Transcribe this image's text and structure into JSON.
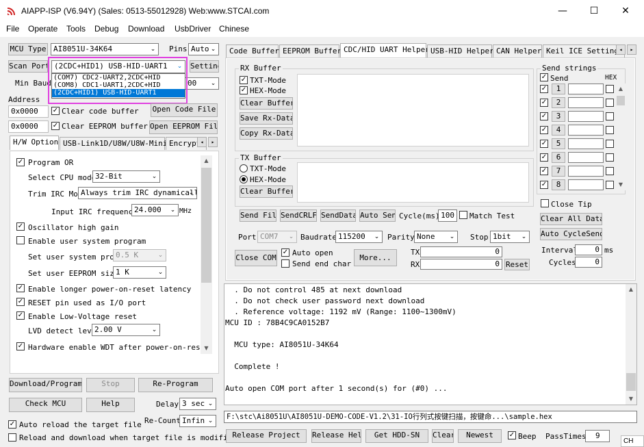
{
  "window": {
    "title": "AIAPP-ISP (V6.94Y) (Sales: 0513-55012928) Web:www.STCAI.com"
  },
  "menu": [
    "File",
    "Operate",
    "Tools",
    "Debug",
    "Download",
    "UsbDriver",
    "Chinese"
  ],
  "left": {
    "mcu_type_label": "MCU Type",
    "mcu_type_value": "AI8051U-34K64",
    "pins_label": "Pins",
    "pins_value": "Auto",
    "scan_port_label": "Scan Port",
    "port_value": "(2CDC+HID1) USB-HID-UART1",
    "port_options": [
      "(COM7) CDC2-UART2,2CDC+HID",
      "(COM8) CDC1-UART1,2CDC+HID",
      "(2CDC+HID1) USB-HID-UART1"
    ],
    "setting_label": "Setting",
    "min_baud_label": "Min Baud",
    "baud_partial": "00",
    "address_label": "Address",
    "addr1": "0x0000",
    "clear_code": "Clear code buffer",
    "open_code": "Open Code File",
    "addr2": "0x0000",
    "clear_eeprom": "Clear EEPROM buffer",
    "open_eeprom": "Open EEPROM File"
  },
  "hw_tabs": [
    "H/W Option",
    "USB-Link1D/U8W/U8W-Mini",
    "Encrypti"
  ],
  "hw": {
    "program_or": "Program OR",
    "cpu_mode_label": "Select CPU mode",
    "cpu_mode_value": "32-Bit",
    "trim_label": "Trim IRC Mo",
    "trim_value": "Always trim IRC dynamicall",
    "irc_label": "Input IRC frequency",
    "irc_value": "24.000",
    "irc_unit": "MHz",
    "osc_gain": "Oscillator high gain",
    "user_sys": "Enable user system program",
    "user_sys_prog_label": "Set user system prog",
    "user_sys_prog_value": "0.5 K",
    "eeprom_label": "Set user EEPROM size",
    "eeprom_value": "1  K",
    "longer_por": "Enable longer power-on-reset latency",
    "reset_io": "RESET pin used as I/O port",
    "low_volt": "Enable Low-Voltage reset",
    "lvd_label": "LVD detect leve",
    "lvd_value": "2.00 V",
    "wdt": "Hardware enable WDT after power-on-reset"
  },
  "bottom_left": {
    "download": "Download/Program",
    "stop": "Stop",
    "reprogram": "Re-Program",
    "check_mcu": "Check MCU",
    "help": "Help",
    "delay_label": "Delay",
    "delay_value": "3 sec",
    "recount_label": "Re-Count",
    "recount_value": "Infin",
    "auto_reload": "Auto reload the target file",
    "reload_dl": "Reload and download when target file is modified"
  },
  "right_tabs": [
    "Code Buffer",
    "EEPROM Buffer",
    "CDC/HID UART Helper",
    "USB-HID Helper",
    "CAN Helper",
    "Keil ICE Settings"
  ],
  "uart": {
    "rx_title": "RX Buffer",
    "rx_txt": "TXT-Mode",
    "rx_hex": "HEX-Mode",
    "clear_buffer": "Clear Buffer",
    "save_rx": "Save Rx-Data",
    "copy_rx": "Copy Rx-Data",
    "tx_title": "TX Buffer",
    "tx_txt": "TXT-Mode",
    "tx_hex": "HEX-Mode",
    "tx_clear": "Clear Buffer",
    "send_file": "Send File",
    "send_crlf": "SendCRLF",
    "send_data": "SendData",
    "auto_send": "Auto Send",
    "cycle_label": "Cycle(ms)",
    "cycle_value": "100",
    "match_test": "Match Test",
    "port_label": "Port",
    "port_value": "COM7",
    "baud_label": "Baudrate",
    "baud_value": "115200",
    "parity_label": "Parity",
    "parity_value": "None",
    "stop_label": "Stop",
    "stop_value": "1bit",
    "close_com": "Close COM",
    "auto_open": "Auto open",
    "send_end": "Send end char",
    "more": "More...",
    "tx_label": "TX",
    "tx_count": "0",
    "rx_label": "RX",
    "rx_count": "0",
    "reset": "Reset",
    "send_strings_title": "Send strings",
    "send_header": "Send",
    "hex_header": "HEX",
    "send_nums": [
      "1",
      "2",
      "3",
      "4",
      "5",
      "6",
      "7",
      "8"
    ],
    "close_tip": "Close Tip",
    "clear_all": "Clear All Data",
    "auto_cycle": "Auto CycleSend",
    "interval_label": "Interval",
    "interval_value": "0",
    "interval_unit": "ms",
    "cycles_label": "Cycles",
    "cycles_value": "0"
  },
  "log": [
    "  . Do not control 485 at next download",
    "  . Do not check user password next download",
    "  . Reference voltage: 1192 mV (Range: 1100~1300mV)",
    "MCU ID : 78B4C9CA0152B7",
    "",
    "  MCU type: AI8051U-34K64",
    "",
    "  Complete !",
    "",
    "Auto open COM port after 1 second(s) for (#0) ..."
  ],
  "file_path": "F:\\stc\\Ai8051U\\AI8051U-DEMO-CODE-V1.2\\31-IO行列式按键扫描，按键命...\\sample.hex",
  "status": {
    "release_project": "Release Project",
    "release_help": "Release Help",
    "get_hdd": "Get HDD-SN",
    "clear": "Clear",
    "newest": "Newest",
    "beep": "Beep",
    "pass_label": "PassTimes",
    "pass_value": "9",
    "ime": "CH"
  },
  "colors": {
    "highlight": "#0078d7",
    "callout": "#e040e0"
  }
}
